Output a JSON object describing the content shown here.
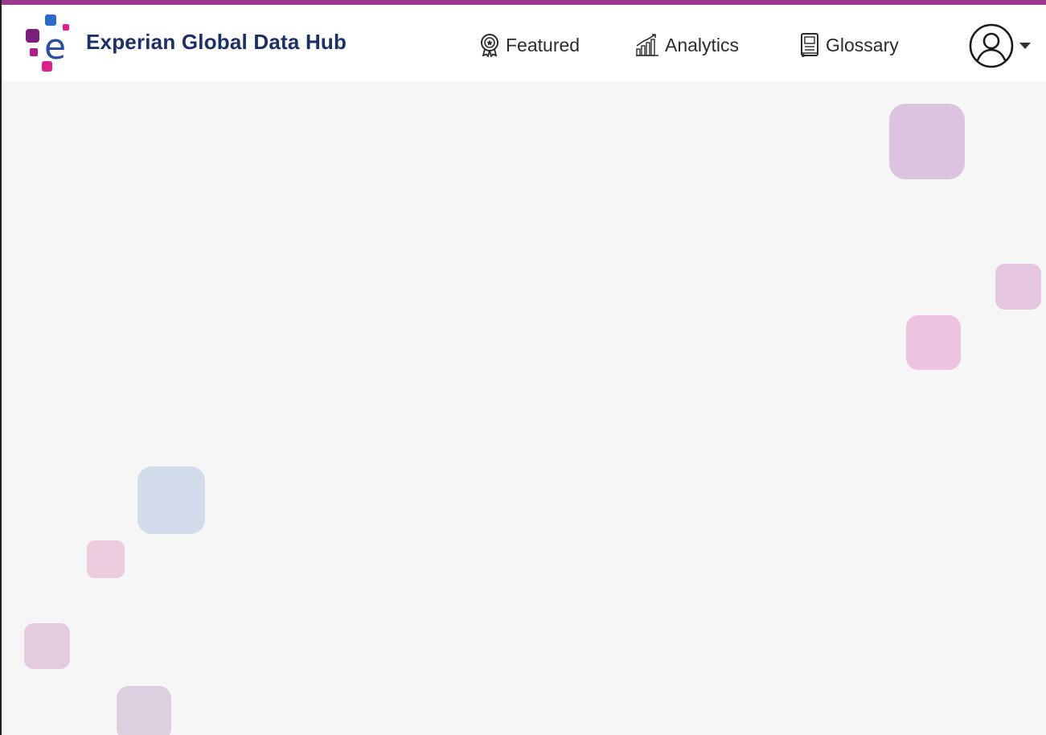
{
  "app": {
    "brand_name": "Experian Global Data Hub",
    "accent_color": "#9b3a8f",
    "brand_color": "#1d2f6b"
  },
  "nav": {
    "items": [
      {
        "label": "Featured",
        "icon": "award-badge-icon"
      },
      {
        "label": "Analytics",
        "icon": "bar-chart-icon"
      },
      {
        "label": "Glossary",
        "icon": "book-icon"
      }
    ]
  },
  "user_menu": {
    "icon": "user-avatar-icon",
    "dropdown_icon": "caret-down-icon"
  },
  "decoration": {
    "colors": {
      "purple": "#dcc4e0",
      "pink": "#edc4e0",
      "blue": "#d1dbea",
      "mauve": "#e5cbe0",
      "lilac": "#dccfe0"
    }
  }
}
